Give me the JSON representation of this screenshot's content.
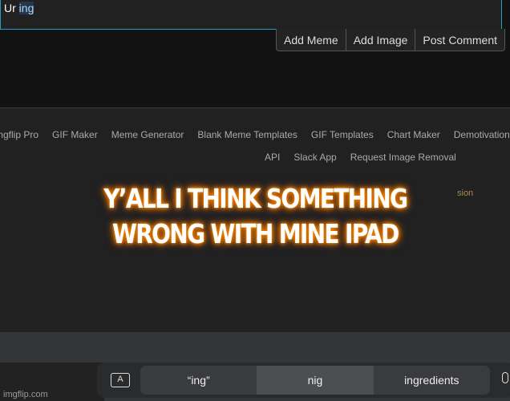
{
  "comment_box": {
    "text": "Ur ",
    "selected": "ing"
  },
  "buttons": [
    "Add Meme",
    "Add Image",
    "Post Comment"
  ],
  "footer": {
    "nav1": [
      "mgflip Pro",
      "GIF Maker",
      "Meme Generator",
      "Blank Meme Templates",
      "GIF Templates",
      "Chart Maker",
      "Demotivational Ma"
    ],
    "nav2": [
      "API",
      "Slack App",
      "Request Image Removal"
    ],
    "fragment": "sion"
  },
  "caption": {
    "line1": "Y’ALL I THINK SOMETHING",
    "line2": "WRONG WITH MINE IPAD",
    "glow_color": "#f08000"
  },
  "keyboard": {
    "suggestions": [
      "“ing”",
      "nig",
      "ingredients"
    ],
    "format_key": "A",
    "mic_icon": "microphone-icon"
  },
  "browser": {
    "url": "imgflip.com"
  }
}
